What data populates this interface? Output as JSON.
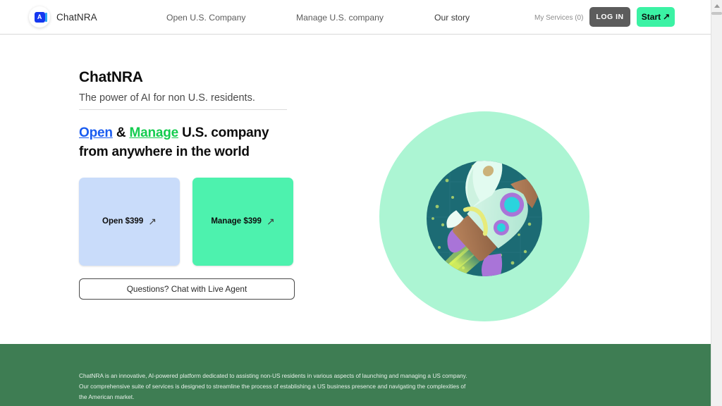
{
  "brand": {
    "name": "ChatNRA",
    "logo_letter": "A",
    "logo_color": "#1437f0",
    "accent_color": "#2ea6f5"
  },
  "nav": {
    "links": [
      {
        "label": "Open U.S. Company"
      },
      {
        "label": "Manage U.S. company"
      },
      {
        "label": "Our story"
      }
    ],
    "my_services": "My Services (0)",
    "login_label": "LOG IN",
    "start_label": "Start",
    "start_icon": "arrow-up-right-icon",
    "login_bg": "#5c5c5c",
    "start_bg": "#3bf2a4"
  },
  "hero": {
    "title": "ChatNRA",
    "subtitle": "The power of AI for non U.S. residents.",
    "headline": {
      "open": "Open",
      "amp": " & ",
      "manage": "Manage",
      "tail": " U.S. company",
      "line2": "from anywhere in the world",
      "open_color": "#1a5cf0",
      "manage_color": "#14cc4f"
    },
    "cards": [
      {
        "label": "Open $399",
        "icon": "arrow-up-right-icon",
        "bg": "#c9dcfa"
      },
      {
        "label": "Manage $399",
        "icon": "arrow-up-right-icon",
        "bg": "#4df2ae"
      }
    ],
    "chat_button": "Questions? Chat with Live Agent",
    "illustration": {
      "name": "rocket-illustration",
      "outer_circle_color": "#acf5d3",
      "inner_circle_color": "#1c6b74"
    }
  },
  "footer": {
    "bg": "#3e7d53",
    "text": "ChatNRA is an innovative, AI-powered platform dedicated to assisting non-US residents in various aspects of launching and managing a US company. Our comprehensive suite of services is designed to streamline the process of establishing a US business presence and navigating the complexities of the American market."
  },
  "scrollbar": {
    "up_icon": "triangle-up-icon"
  }
}
